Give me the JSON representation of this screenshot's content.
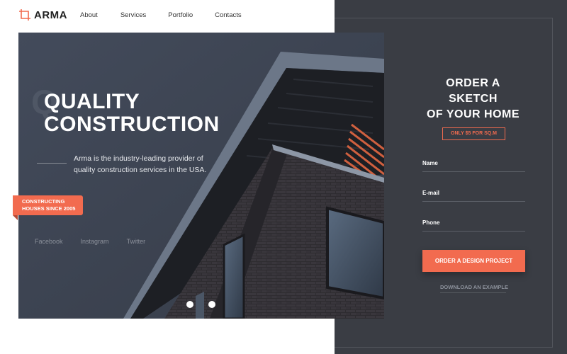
{
  "brand": {
    "name": "ARMA",
    "accent": "#f26b4f"
  },
  "nav": {
    "items": [
      "About",
      "Services",
      "Portfolio",
      "Contacts"
    ]
  },
  "hero": {
    "title_line1": "QUALITY",
    "title_line2": "CONSTRUCTION",
    "ghost_letter": "Q",
    "description": "Arma is the industry-leading provider of quality construction services in the USA.",
    "badge_line1": "CONSTRUCTING",
    "badge_line2": "HOUSES SINCE 2005",
    "social": [
      "Facebook",
      "Instagram",
      "Twitter"
    ],
    "slider_dots": 2
  },
  "order_form": {
    "title_line1": "ORDER A",
    "title_line2": "SKETCH",
    "title_line3": "OF YOUR HOME",
    "price_badge": "ONLY $5 FOR SQ.M",
    "fields": {
      "name": "Name",
      "email": "E-mail",
      "phone": "Phone"
    },
    "submit_label": "ORDER A DESIGN PROJECT",
    "download_label": "DOWNLOAD AN EXAMPLE"
  },
  "colors": {
    "dark_panel": "#3a3d44",
    "hero_bg": "#3c4352",
    "accent": "#f26b4f"
  }
}
